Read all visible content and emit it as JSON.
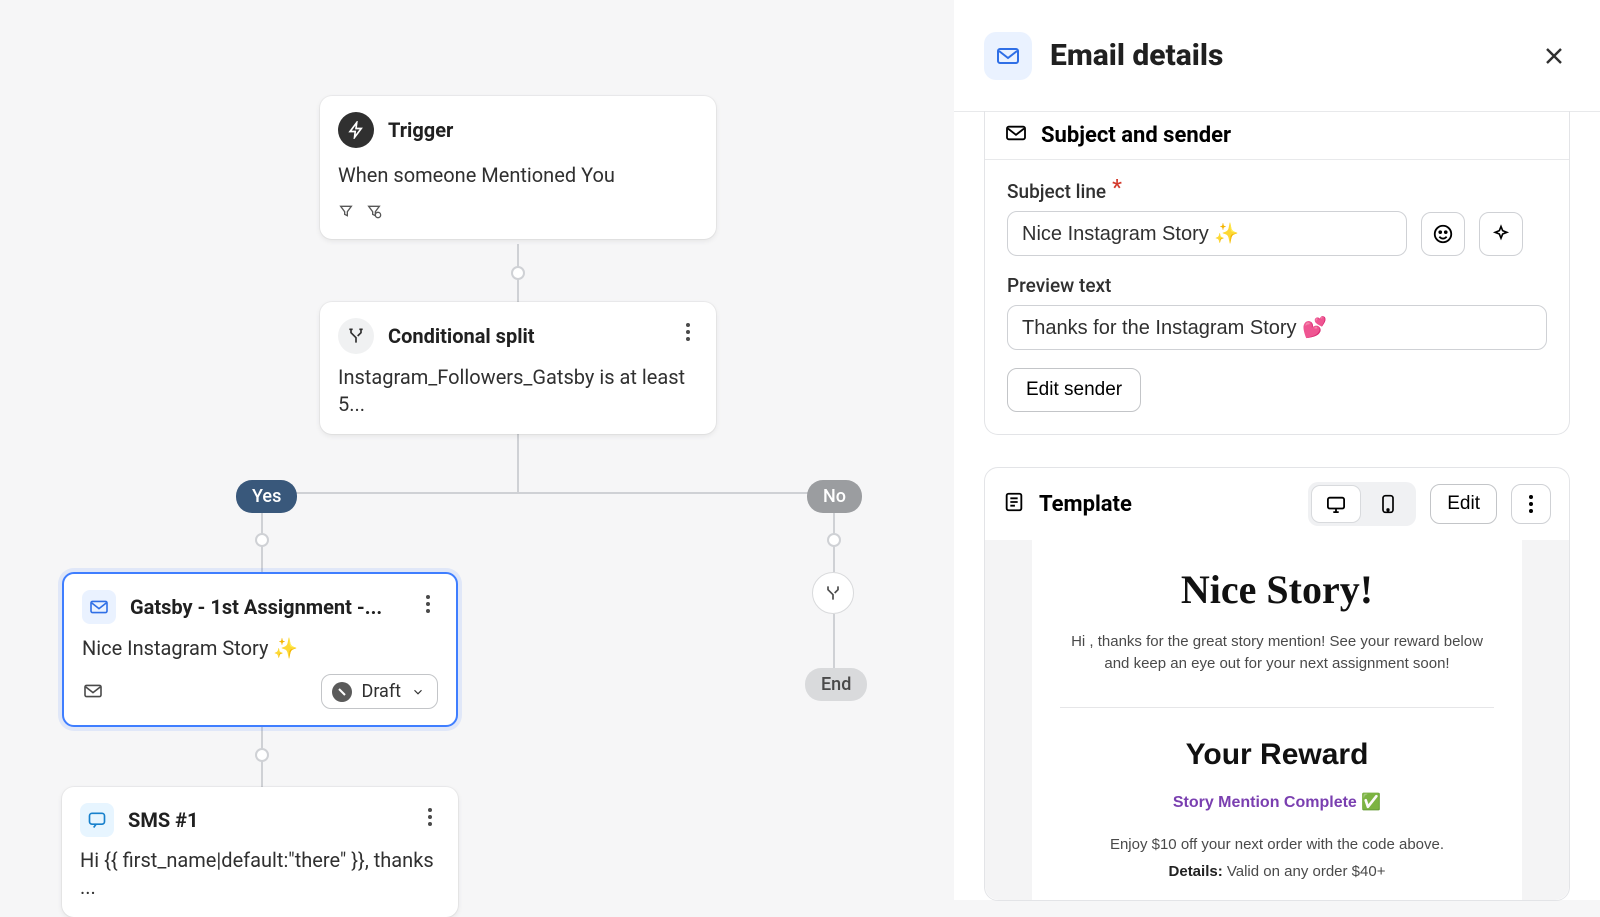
{
  "flow": {
    "trigger": {
      "title": "Trigger",
      "desc": "When someone Mentioned You"
    },
    "split": {
      "title": "Conditional split",
      "desc": "Instagram_Followers_Gatsby is at least 5..."
    },
    "branches": {
      "yes": "Yes",
      "no": "No",
      "end": "End"
    },
    "email_node": {
      "title": "Gatsby - 1st Assignment -...",
      "subject": "Nice Instagram Story ✨",
      "status": "Draft"
    },
    "sms_node": {
      "title": "SMS #1",
      "body": "Hi {{ first_name|default:\"there\" }}, thanks ..."
    }
  },
  "panel": {
    "title": "Email details",
    "subject_sender": {
      "heading": "Subject and sender",
      "subject_label": "Subject line",
      "subject_value": "Nice Instagram Story ✨",
      "preview_label": "Preview text",
      "preview_value": "Thanks for the Instagram Story 💕",
      "edit_sender": "Edit sender"
    },
    "template": {
      "heading": "Template",
      "edit": "Edit",
      "preview": {
        "h1": "Nice Story!",
        "p1": "Hi , thanks for the great story mention! See your reward below and keep an eye out for your next assignment soon!",
        "h2": "Your Reward",
        "badge": "Story Mention Complete ✅",
        "line1": "Enjoy $10 off your next order with the code above.",
        "details_label": "Details:",
        "details_rest": " Valid on any order $40+"
      }
    }
  }
}
